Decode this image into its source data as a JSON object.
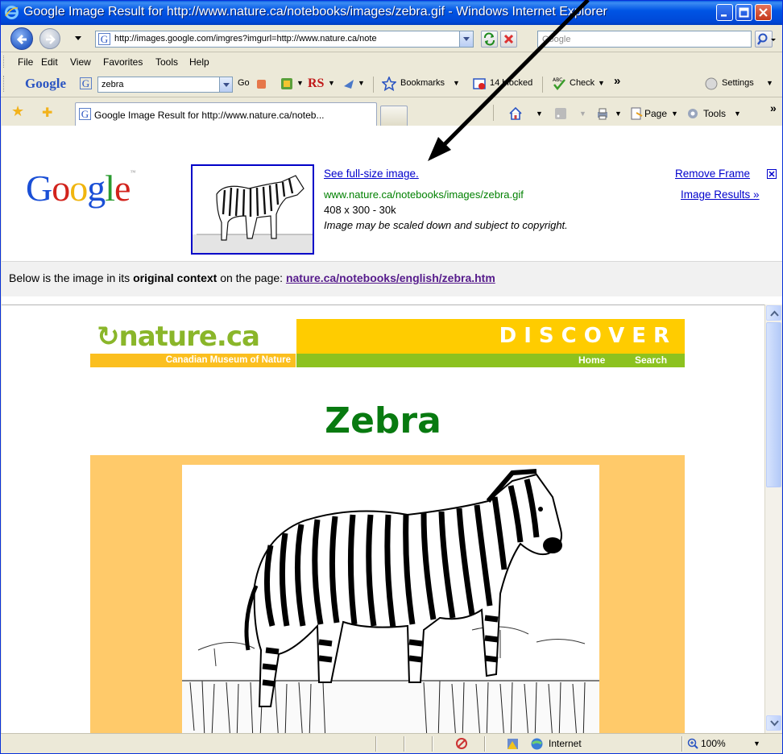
{
  "window": {
    "title": "Google Image Result for http://www.nature.ca/notebooks/images/zebra.gif - Windows Internet Explorer"
  },
  "address_bar": {
    "url": "http://images.google.com/imgres?imgurl=http://www.nature.ca/note",
    "search_placeholder": "Google"
  },
  "menu": [
    "File",
    "Edit",
    "View",
    "Favorites",
    "Tools",
    "Help"
  ],
  "google_toolbar": {
    "logo": "Google",
    "search_value": "zebra",
    "go_label": "Go",
    "rs_label": "RS",
    "bookmarks_label": "Bookmarks",
    "blocked_label": "14 blocked",
    "check_label": "Check",
    "settings_label": "Settings",
    "more_label": "»"
  },
  "tabs": {
    "active_label": "Google Image Result for http://www.nature.ca/noteb...",
    "page_label": "Page",
    "tools_label": "Tools",
    "more_label": "»"
  },
  "google_frame": {
    "logo": "Google",
    "see_full_size": "See full-size image.",
    "image_url": "www.nature.ca/notebooks/images/zebra.gif",
    "image_info": "408 x 300 - 30k",
    "disclaimer": "Image may be scaled down and subject to copyright.",
    "remove_frame": "Remove Frame",
    "image_results": "Image Results »",
    "context_prefix": "Below is the image in its",
    "context_bold": "original context",
    "context_mid": "on the page:",
    "context_link": "nature.ca/notebooks/english/zebra.htm"
  },
  "page": {
    "site_logo": "nature.ca",
    "site_subtitle": "Canadian Museum of Nature",
    "discover": "DISCOVER",
    "nav_home": "Home",
    "nav_search": "Search",
    "heading": "Zebra"
  },
  "status_bar": {
    "zone": "Internet",
    "zoom": "100%"
  },
  "colors": {
    "title_bar": "#0055e5",
    "nature_green": "#8cc21f",
    "nature_yellow": "#ffcc00",
    "heading_green": "#087a10",
    "panel_orange": "#ffca6a"
  }
}
